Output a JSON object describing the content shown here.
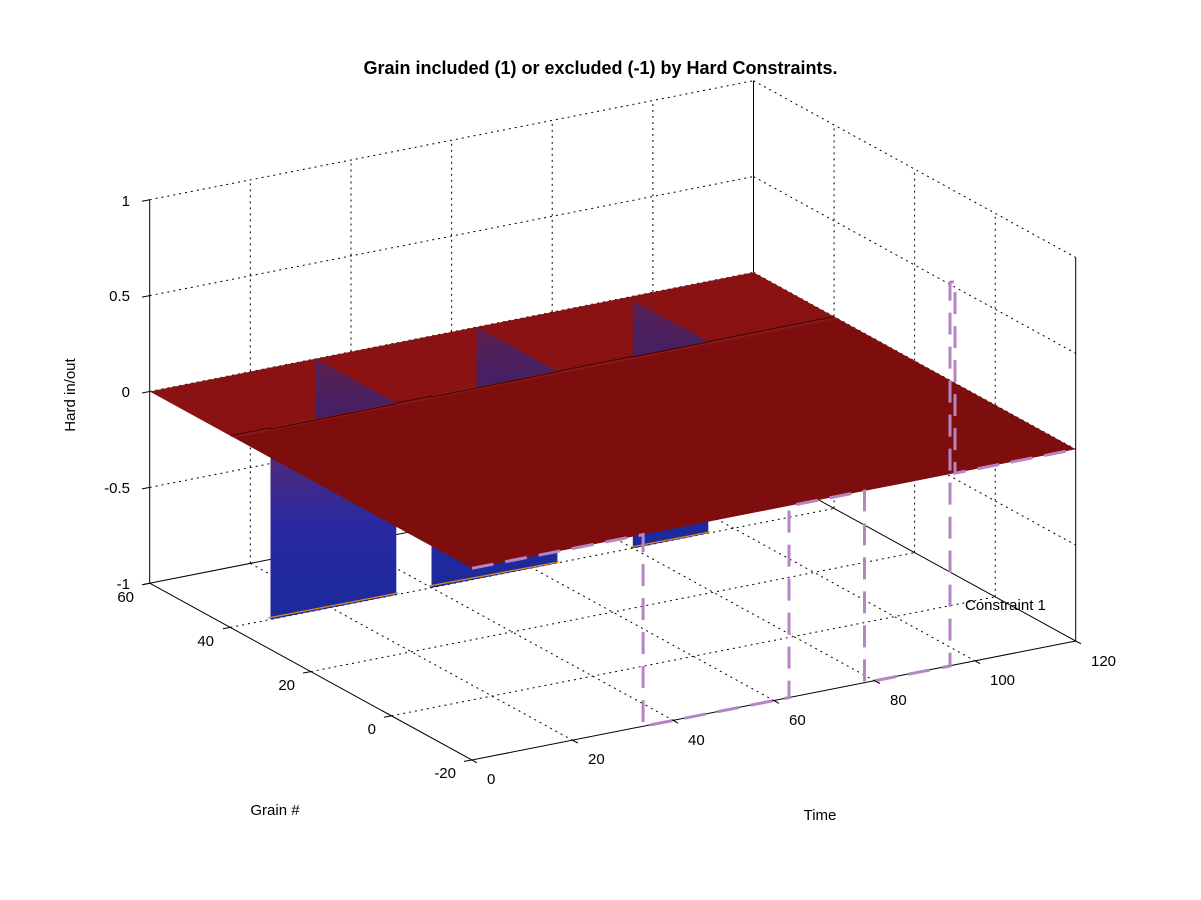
{
  "chart_data": {
    "type": "surface3d",
    "title": "Grain included (1) or excluded (-1) by Hard Constraints.",
    "xlabel": "Time",
    "ylabel": "Grain #",
    "zlabel": "Hard in/out",
    "xlim": [
      0,
      120
    ],
    "ylim": [
      -20,
      60
    ],
    "zlim": [
      -1,
      1
    ],
    "xticks": [
      0,
      20,
      40,
      60,
      80,
      100,
      120
    ],
    "yticks": [
      -20,
      0,
      20,
      40,
      60
    ],
    "zticks": [
      -1,
      -0.5,
      0,
      0.5,
      1
    ],
    "surface_description": "Z = 0 slab across Grain×Time domain; at Grain≈0 three blocks drop to Z = -1 over Time windows ≈[8,33], [40,65], [80,95]",
    "colormap_description": "jet-like: dark red at top surface, purple/blue walls, orange at bottom edge",
    "overlays": [
      {
        "name": "Constraint 1",
        "style": "dashed-magenta",
        "path_description": "at Grain=-20: z=0 for Time 0→~34, drops to z=-1 for ~34→~63, returns to z=0 for ~63→~78, drops to z=-1 for ~78→~95, returns to z=0 and rises to z≈1 near Time 95 then back to 0 to Time 120"
      }
    ],
    "legend": {
      "entries": [
        "Constraint 1"
      ],
      "position": "lower-right"
    }
  },
  "labels": {
    "title": "Grain included (1) or excluded (-1) by Hard Constraints.",
    "xlabel": "Time",
    "ylabel": "Grain #",
    "zlabel": "Hard in/out",
    "legend0": "Constraint 1",
    "xt0": "0",
    "xt1": "20",
    "xt2": "40",
    "xt3": "60",
    "xt4": "80",
    "xt5": "100",
    "xt6": "120",
    "yt0": "-20",
    "yt1": "0",
    "yt2": "20",
    "yt3": "40",
    "yt4": "60",
    "zt0": "-1",
    "zt1": "-0.5",
    "zt2": "0",
    "zt3": "0.5",
    "zt4": "1"
  },
  "colors": {
    "surface_top": "#7e0d0d",
    "wall_top": "#5a2a6e",
    "wall_bottom": "#1a2a8a",
    "edge_bottom": "#e38a1e",
    "constraint": "#b585c1"
  }
}
